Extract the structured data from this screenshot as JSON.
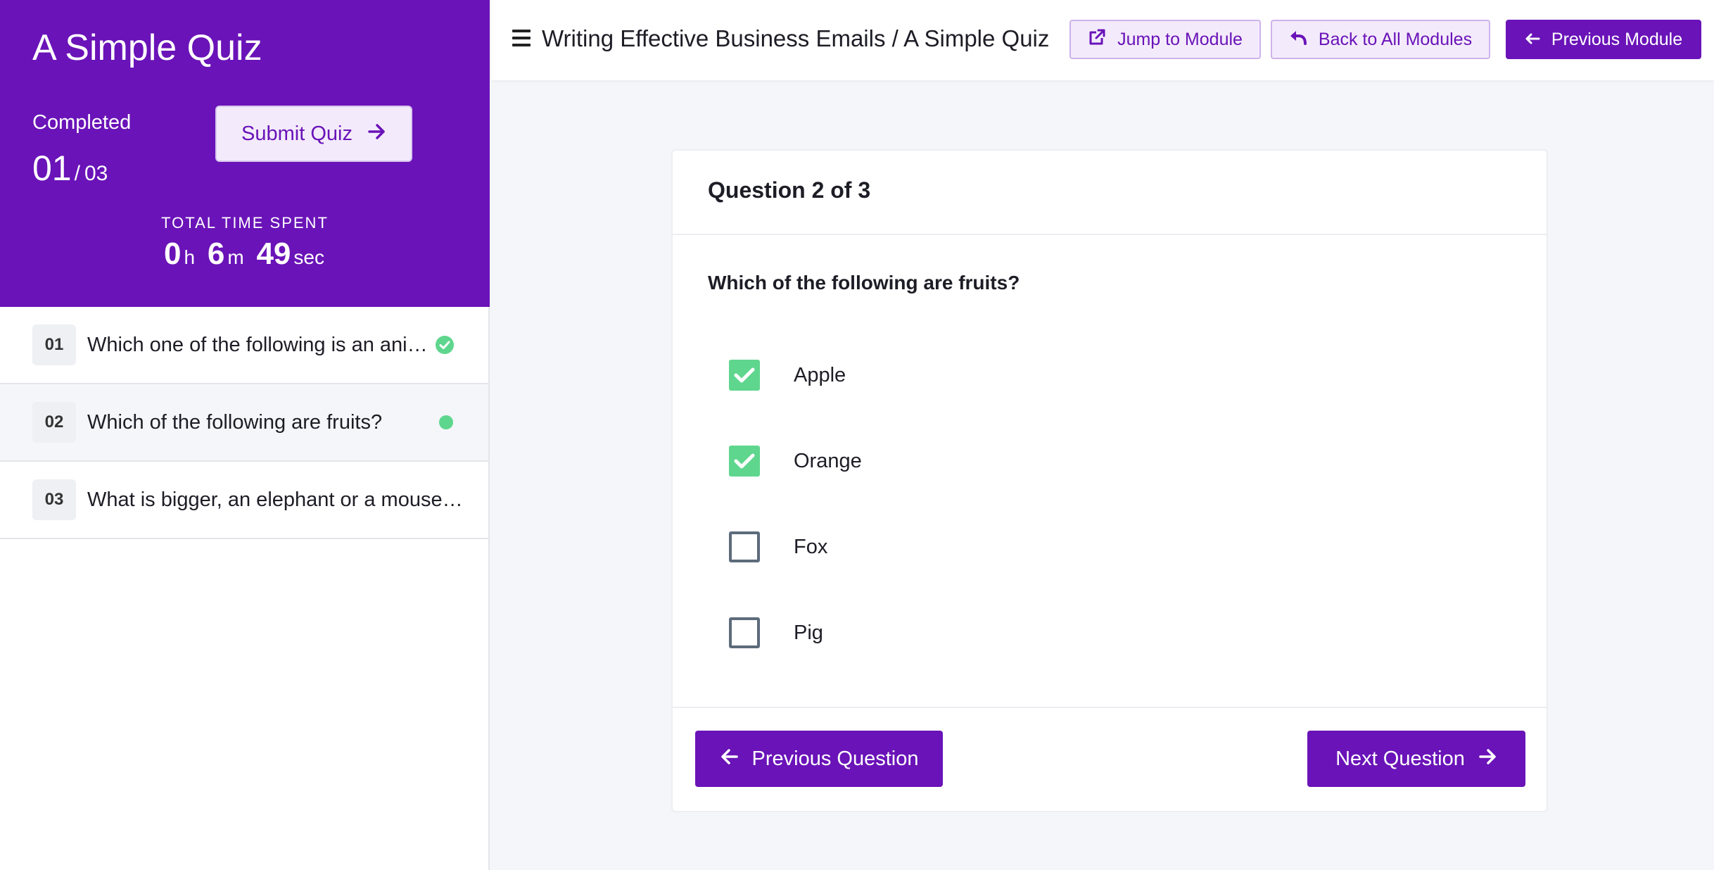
{
  "sidebar": {
    "title": "A Simple Quiz",
    "completed_label": "Completed",
    "completed_count": "01",
    "completed_sep": "/",
    "completed_total": "03",
    "submit_label": "Submit Quiz",
    "time_label": "TOTAL TIME SPENT",
    "time": {
      "hours": "0",
      "h": "h",
      "minutes": "6",
      "m": "m",
      "seconds": "49",
      "s": "sec"
    },
    "questions": [
      {
        "num": "01",
        "text": "Which one of the following is an ani…",
        "status": "answered"
      },
      {
        "num": "02",
        "text": "Which of the following are fruits?",
        "status": "current"
      },
      {
        "num": "03",
        "text": "What is bigger, an elephant or a mouse…",
        "status": "none"
      }
    ]
  },
  "header": {
    "breadcrumb": "Writing Effective Business Emails / A Simple Quiz",
    "jump_label": "Jump to Module",
    "back_label": "Back to All Modules",
    "prev_module_label": "Previous Module"
  },
  "question": {
    "heading": "Question 2 of 3",
    "text": "Which of the following are fruits?",
    "options": [
      {
        "label": "Apple",
        "checked": true
      },
      {
        "label": "Orange",
        "checked": true
      },
      {
        "label": "Fox",
        "checked": false
      },
      {
        "label": "Pig",
        "checked": false
      }
    ],
    "prev_label": "Previous Question",
    "next_label": "Next Question"
  },
  "colors": {
    "brand": "#6a13b8",
    "success": "#5ed68d",
    "background": "#f4f6f9"
  },
  "icons": [
    "arrow-right-icon",
    "hamburger-icon",
    "external-link-icon",
    "reply-arrow-icon",
    "arrow-left-icon",
    "check-circle-icon",
    "status-dot-icon",
    "checkmark-icon"
  ]
}
